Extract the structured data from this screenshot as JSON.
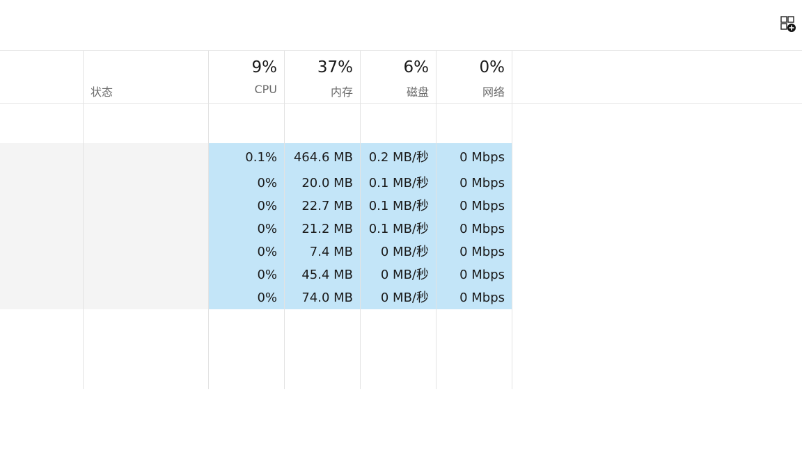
{
  "toolbar": {
    "icon": "add-widget-icon"
  },
  "header": {
    "status_label": "状态",
    "columns": [
      {
        "key": "cpu",
        "percent": "9%",
        "label": "CPU"
      },
      {
        "key": "memory",
        "percent": "37%",
        "label": "内存"
      },
      {
        "key": "disk",
        "percent": "6%",
        "label": "磁盘"
      },
      {
        "key": "network",
        "percent": "0%",
        "label": "网络"
      }
    ]
  },
  "rows": [
    {
      "cpu": "0.1%",
      "memory": "464.6 MB",
      "disk": "0.2 MB/秒",
      "network": "0 Mbps"
    },
    {
      "cpu": "0%",
      "memory": "20.0 MB",
      "disk": "0.1 MB/秒",
      "network": "0 Mbps"
    },
    {
      "cpu": "0%",
      "memory": "22.7 MB",
      "disk": "0.1 MB/秒",
      "network": "0 Mbps"
    },
    {
      "cpu": "0%",
      "memory": "21.2 MB",
      "disk": "0.1 MB/秒",
      "network": "0 Mbps"
    },
    {
      "cpu": "0%",
      "memory": "7.4 MB",
      "disk": "0 MB/秒",
      "network": "0 Mbps"
    },
    {
      "cpu": "0%",
      "memory": "45.4 MB",
      "disk": "0 MB/秒",
      "network": "0 Mbps"
    },
    {
      "cpu": "0%",
      "memory": "74.0 MB",
      "disk": "0 MB/秒",
      "network": "0 Mbps"
    }
  ],
  "colors": {
    "selection": "#c3e5f8",
    "selection_side": "#f4f4f4",
    "header_label": "#6b6b6b"
  }
}
